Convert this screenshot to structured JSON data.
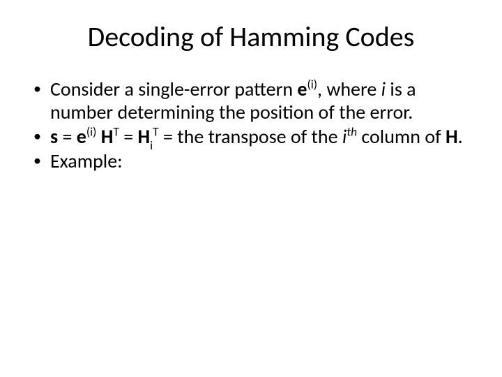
{
  "title": "Decoding of Hamming Codes",
  "bullets": {
    "b1": {
      "t1": "Consider a single-error pattern ",
      "e": "e",
      "sup_i": "(i)",
      "t2": ", where ",
      "i_var": "i",
      "t3": " is a number determining the position of the error."
    },
    "b2": {
      "s": "s",
      "eq1": " = ",
      "e": "e",
      "sup_i": "(i)",
      "sp": " ",
      "H1": "H",
      "T1": "T",
      "eq2": " = ",
      "H2": "H",
      "sub_i": "i",
      "T2": "T",
      "eq3": " = the transpose of the ",
      "i_var": "i",
      "th": "th",
      "t_end": " column of ",
      "H3": "H",
      "dot": "."
    },
    "b3": {
      "t": "Example:"
    }
  }
}
